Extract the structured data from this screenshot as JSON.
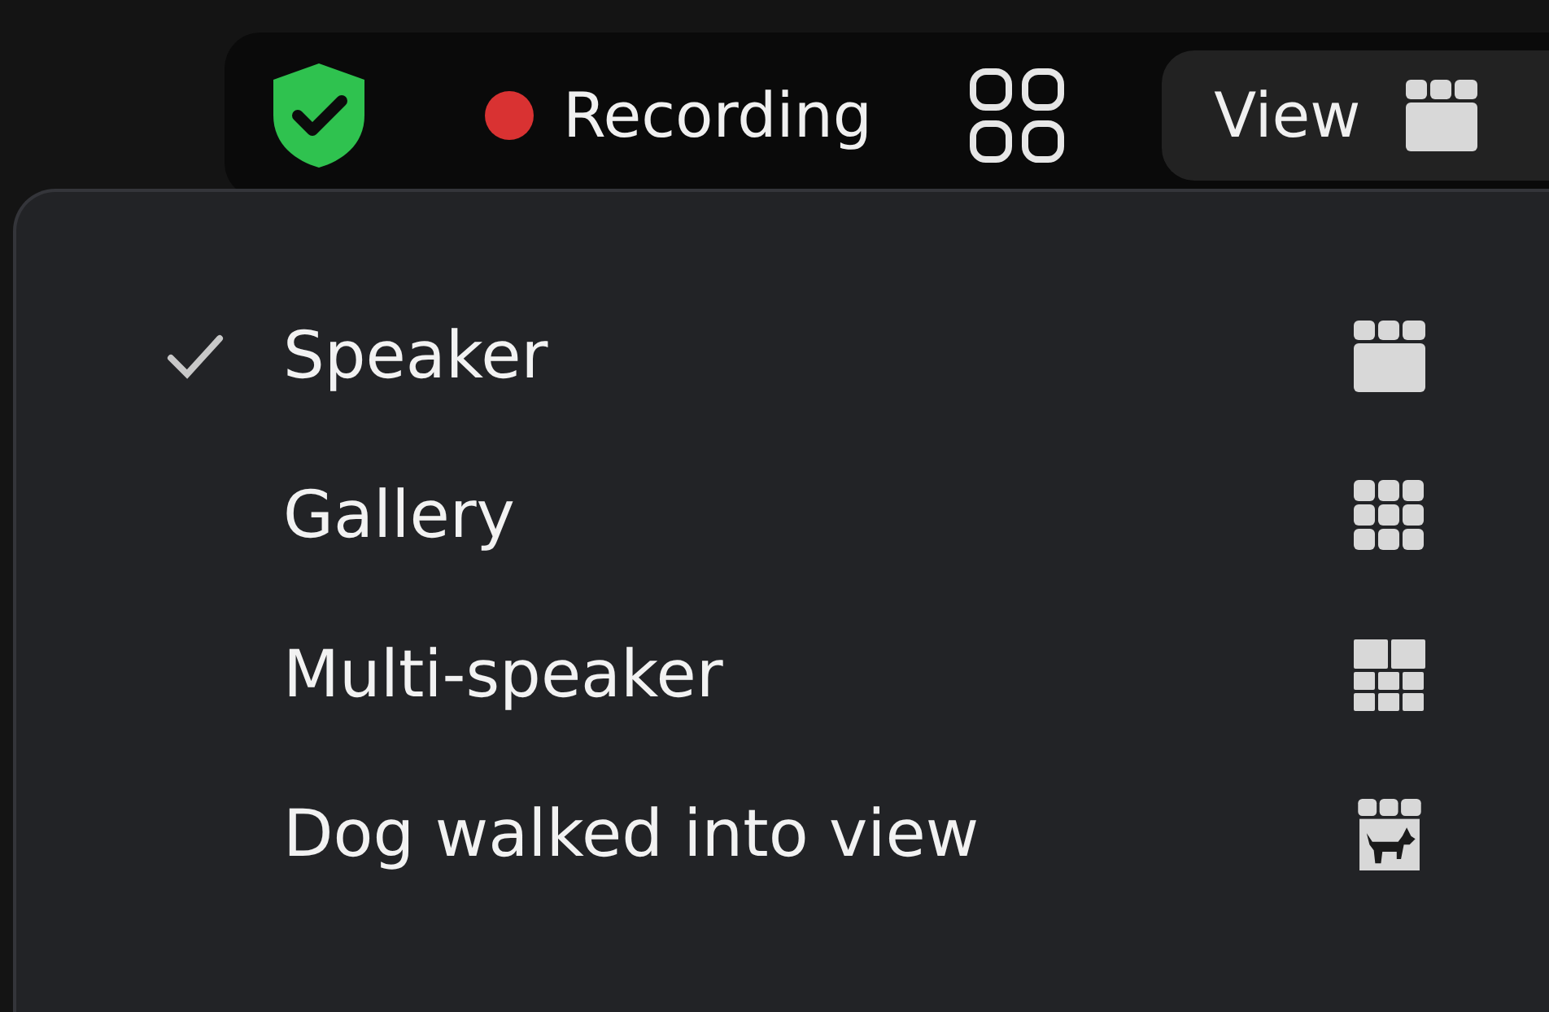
{
  "toolbar": {
    "recording": {
      "label": "Recording",
      "on": true
    },
    "view_button": {
      "label": "View"
    }
  },
  "view_menu": {
    "items": [
      {
        "label": "Speaker",
        "selected": true,
        "kind": "speaker"
      },
      {
        "label": "Gallery",
        "selected": false,
        "kind": "gallery"
      },
      {
        "label": "Multi-speaker",
        "selected": false,
        "kind": "multi"
      },
      {
        "label": "Dog walked into view",
        "selected": false,
        "kind": "dog"
      }
    ]
  }
}
